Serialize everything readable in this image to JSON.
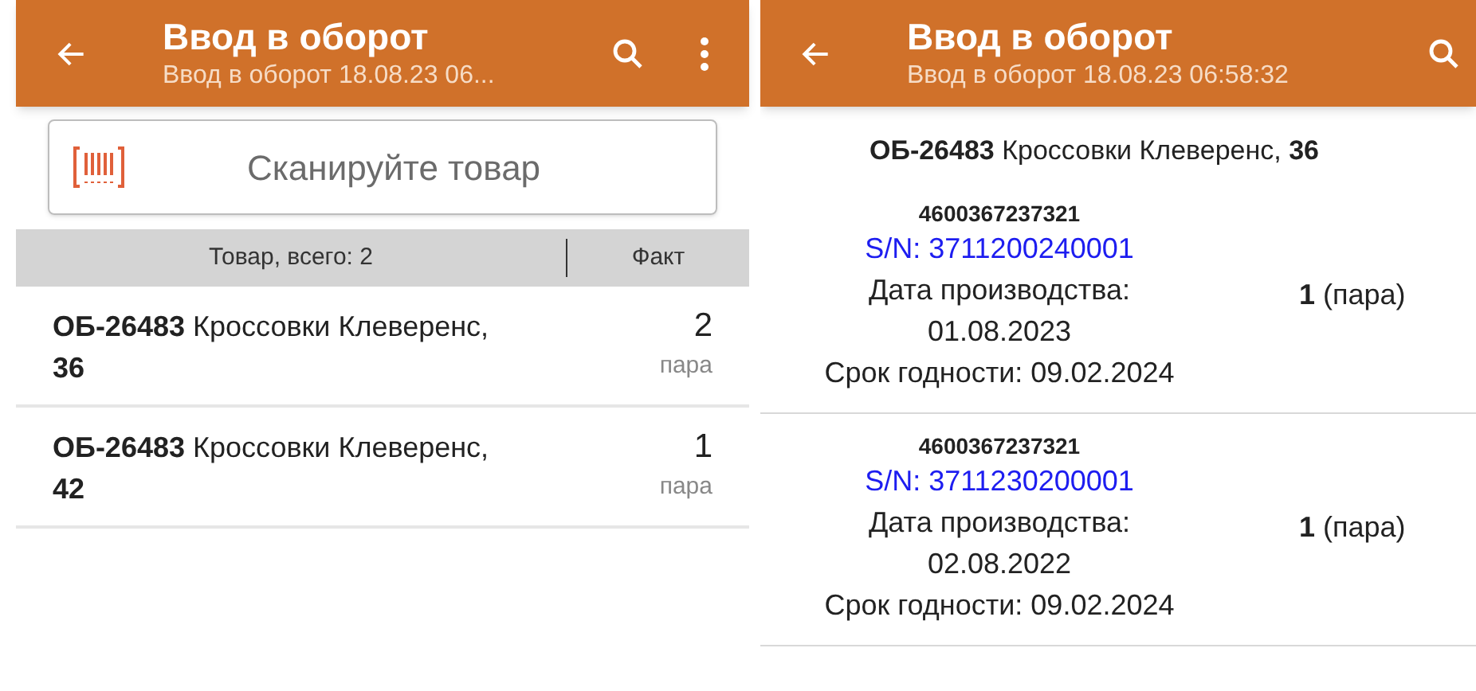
{
  "screens": [
    {
      "header": {
        "title": "Ввод в оборот",
        "subtitle": "Ввод в оборот 18.08.23 06...",
        "menu": true
      },
      "scan_field": {
        "placeholder": "Сканируйте товар"
      },
      "table": {
        "columns": [
          "Товар, всего: 2",
          "Факт"
        ],
        "rows": [
          {
            "product": "**ОБ-26483** Кроссовки Клеверенс, **36**",
            "qty": "2",
            "unit": "пара"
          },
          {
            "product": "**ОБ-26483** Кроссовки Клеверенс, **42**",
            "qty": "1",
            "unit": "пара"
          }
        ]
      }
    },
    {
      "header": {
        "title": "Ввод в оборот",
        "subtitle": "Ввод в оборот 18.08.23 06:58:32",
        "menu": false
      },
      "product_title": "**ОБ-26483** Кроссовки Клеверенс, **36**",
      "items": [
        {
          "barcode": "4600367237321",
          "serial": "S/N: 3711200240001",
          "production_date": "Дата производства: 01.08.2023",
          "expiry": "Срок годности: 09.02.2024",
          "qty": "**1** (пара)"
        },
        {
          "barcode": "4600367237321",
          "serial": "S/N: 3711230200001",
          "production_date": "Дата производства: 02.08.2022",
          "expiry": "Срок годности: 09.02.2024",
          "qty": "**1** (пара)"
        }
      ]
    }
  ]
}
